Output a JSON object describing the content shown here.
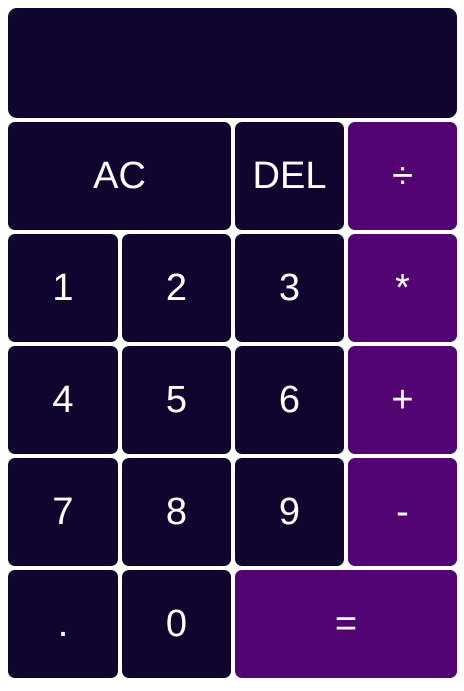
{
  "display": {
    "value": ""
  },
  "buttons": {
    "ac": "AC",
    "del": "DEL",
    "divide": "÷",
    "one": "1",
    "two": "2",
    "three": "3",
    "multiply": "*",
    "four": "4",
    "five": "5",
    "six": "6",
    "add": "+",
    "seven": "7",
    "eight": "8",
    "nine": "9",
    "subtract": "-",
    "decimal": ".",
    "zero": "0",
    "equals": "="
  },
  "colors": {
    "background": "#10052e",
    "operator": "#530473",
    "text": "#ffffff",
    "border": "#ffffff"
  }
}
